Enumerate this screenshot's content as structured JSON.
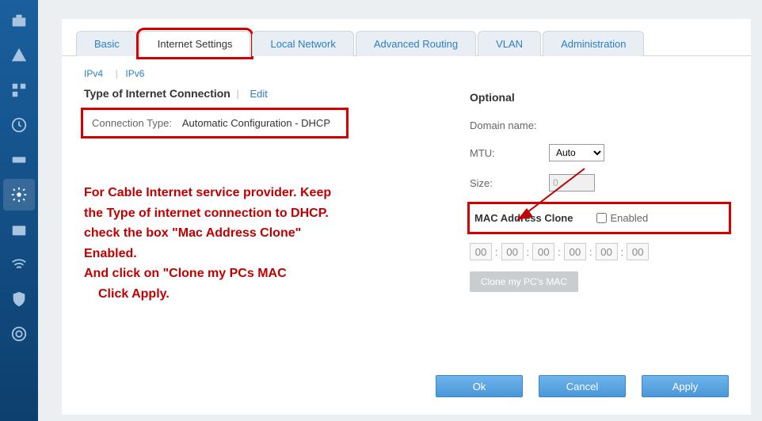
{
  "sidebar": {
    "items": [
      {
        "name": "toolbox-icon"
      },
      {
        "name": "alert-icon"
      },
      {
        "name": "apps-icon"
      },
      {
        "name": "clock-icon"
      },
      {
        "name": "device-icon"
      },
      {
        "name": "settings-icon"
      },
      {
        "name": "medkit-icon"
      },
      {
        "name": "wifi-icon"
      },
      {
        "name": "shield-icon"
      },
      {
        "name": "support-icon"
      }
    ]
  },
  "tabs": {
    "items": [
      "Basic",
      "Internet Settings",
      "Local Network",
      "Advanced Routing",
      "VLAN",
      "Administration"
    ],
    "active": 1
  },
  "subtabs": {
    "ipv4": "IPv4",
    "ipv6": "IPv6"
  },
  "left": {
    "section_title": "Type of Internet Connection",
    "edit": "Edit",
    "conn_label": "Connection Type:",
    "conn_value": "Automatic Configuration - DHCP"
  },
  "annotation": {
    "l1": "For Cable Internet service provider. Keep",
    "l2": "the Type of internet connection to DHCP.",
    "l3": "check the box \"Mac Address Clone\"",
    "l4": "Enabled.",
    "l5": "And click on \"Clone my PCs MAC",
    "l6": "Click Apply."
  },
  "right": {
    "title": "Optional",
    "domain_label": "Domain name:",
    "mtu_label": "MTU:",
    "mtu_value": "Auto",
    "size_label": "Size:",
    "size_value": "0",
    "mac_clone_title": "MAC Address Clone",
    "enabled_label": "Enabled",
    "mac_octets": [
      "00",
      "00",
      "00",
      "00",
      "00",
      "00"
    ],
    "clone_btn": "Clone my PC's MAC"
  },
  "buttons": {
    "ok": "Ok",
    "cancel": "Cancel",
    "apply": "Apply"
  }
}
